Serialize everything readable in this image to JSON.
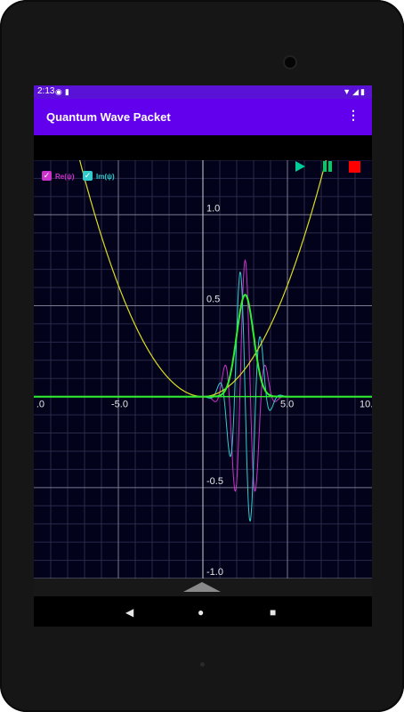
{
  "status_bar": {
    "time": "2:13",
    "left_icons": [
      "notification-p-icon",
      "sd-card-icon"
    ],
    "right_icons": [
      "wifi-icon",
      "signal-icon",
      "battery-icon"
    ]
  },
  "app_bar": {
    "title": "Quantum Wave Packet",
    "overflow_icon": "more-vert-icon"
  },
  "legend": {
    "re_label": "Re(ψ)",
    "im_label": "Im(ψ)",
    "re_checked": true,
    "im_checked": true,
    "re_color": "#cc33cc",
    "im_color": "#33cccc"
  },
  "controls": {
    "play_icon": "play-icon",
    "pause_icon": "pause-icon",
    "stop_icon": "stop-icon",
    "play_color": "#00cc99",
    "pause_color": "#00cc66",
    "stop_color": "#ff0000"
  },
  "chart_data": {
    "type": "line",
    "x_range": [
      -10,
      10
    ],
    "y_range": [
      -1.0,
      1.3
    ],
    "x_tick_labels": [
      ".0",
      "-5.0",
      "5.0",
      "10."
    ],
    "x_tick_values": [
      -10,
      -5,
      5,
      10
    ],
    "y_tick_labels": [
      "1.0",
      "0.5",
      "-0.5",
      "-1.0"
    ],
    "y_tick_values": [
      1.0,
      0.5,
      -0.5,
      -1.0
    ],
    "grid": true,
    "legend_position": "top-left",
    "series": [
      {
        "name": "Re(ψ)",
        "color": "#cc33cc",
        "kind": "wave",
        "center": 2.5,
        "width": 1.0,
        "k": 5.0,
        "amplitude": 0.75,
        "phase": 0.0
      },
      {
        "name": "Im(ψ)",
        "color": "#33cccc",
        "kind": "wave",
        "center": 2.5,
        "width": 1.0,
        "k": 5.0,
        "amplitude": 0.75,
        "phase": 1.5708
      },
      {
        "color": "#33ee33",
        "kind": "density",
        "center": 2.5,
        "width": 1.0,
        "amplitude": 0.56
      },
      {
        "color": "#dddd22",
        "kind": "potential",
        "coefficient": 0.0245
      }
    ]
  },
  "nav_bar": {
    "back_icon": "back-icon",
    "home_icon": "home-icon",
    "recents_icon": "recents-icon"
  }
}
